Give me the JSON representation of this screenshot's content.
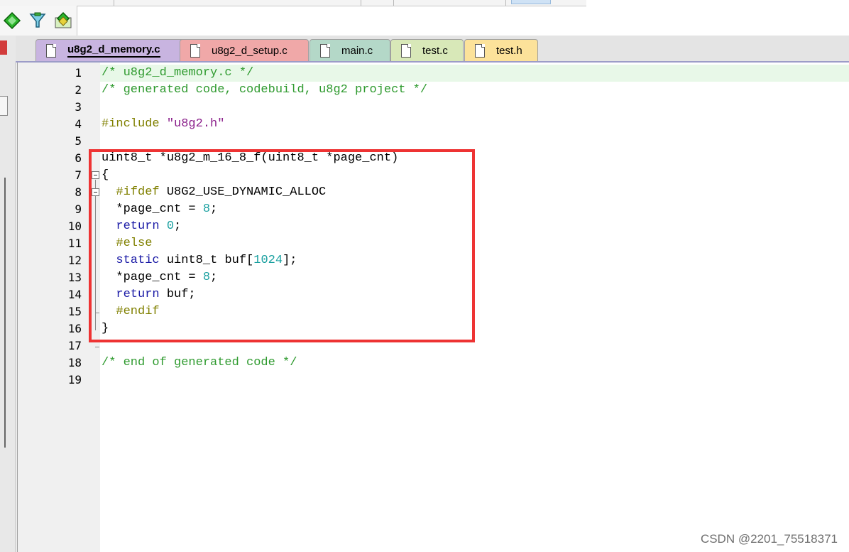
{
  "toolbar": {
    "icons": [
      "green-diamond-icon",
      "filter-icon",
      "stacked-diamonds-icon"
    ]
  },
  "tabs": [
    {
      "label": "u8g2_d_memory.c",
      "color": "#c8b4e0",
      "active": true
    },
    {
      "label": "u8g2_d_setup.c",
      "color": "#f0a8a8",
      "active": false
    },
    {
      "label": "main.c",
      "color": "#b4d8c8",
      "active": false
    },
    {
      "label": "test.c",
      "color": "#d8e8b8",
      "active": false
    },
    {
      "label": "test.h",
      "color": "#fce29a",
      "active": false
    }
  ],
  "code_lines": [
    {
      "n": "1",
      "text": "/* u8g2_d_memory.c */"
    },
    {
      "n": "2",
      "text": "/* generated code, codebuild, u8g2 project */"
    },
    {
      "n": "3",
      "text": ""
    },
    {
      "n": "4",
      "text": "#include \"u8g2.h\""
    },
    {
      "n": "5",
      "text": ""
    },
    {
      "n": "6",
      "text": "uint8_t *u8g2_m_16_8_f(uint8_t *page_cnt)"
    },
    {
      "n": "7",
      "text": "{"
    },
    {
      "n": "8",
      "text": "  #ifdef U8G2_USE_DYNAMIC_ALLOC"
    },
    {
      "n": "9",
      "text": "  *page_cnt = 8;"
    },
    {
      "n": "10",
      "text": "  return 0;"
    },
    {
      "n": "11",
      "text": "  #else"
    },
    {
      "n": "12",
      "text": "  static uint8_t buf[1024];"
    },
    {
      "n": "13",
      "text": "  *page_cnt = 8;"
    },
    {
      "n": "14",
      "text": "  return buf;"
    },
    {
      "n": "15",
      "text": "  #endif"
    },
    {
      "n": "16",
      "text": "}"
    },
    {
      "n": "17",
      "text": ""
    },
    {
      "n": "18",
      "text": "/* end of generated code */"
    },
    {
      "n": "19",
      "text": ""
    }
  ],
  "watermark": "CSDN @2201_75518371",
  "colors": {
    "highlight_box": "#ee3333",
    "comment": "#2e9a2e",
    "keyword": "#1a1aa6",
    "number": "#1aa0a0",
    "preprocessor": "#808000",
    "string": "#8a1e8a"
  }
}
